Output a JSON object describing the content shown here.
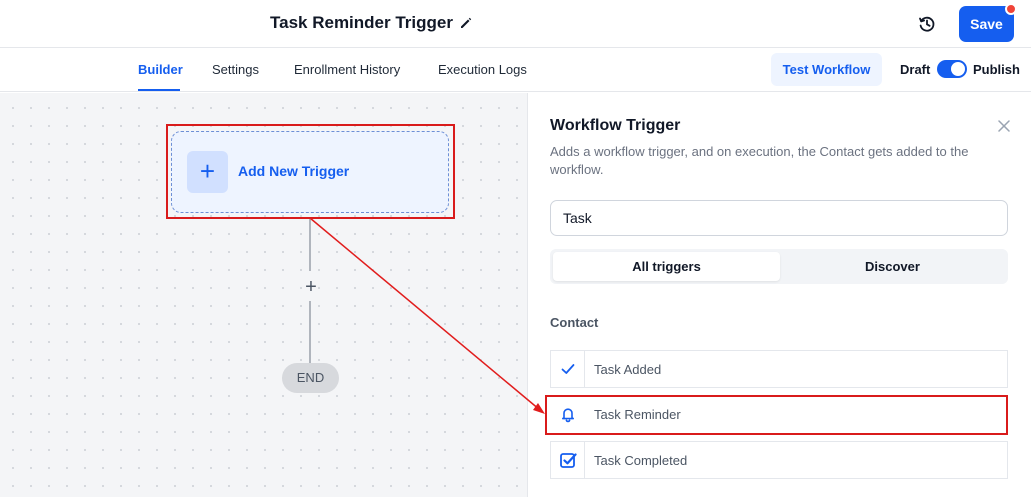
{
  "header": {
    "workflow_title": "Task Reminder Trigger",
    "save_label": "Save"
  },
  "tabs": [
    {
      "label": "Builder",
      "active": true
    },
    {
      "label": "Settings",
      "active": false
    },
    {
      "label": "Enrollment History",
      "active": false
    },
    {
      "label": "Execution Logs",
      "active": false
    }
  ],
  "toolbar": {
    "test_label": "Test Workflow",
    "draft_label": "Draft",
    "publish_label": "Publish",
    "published": true
  },
  "canvas": {
    "trigger_label": "Add New Trigger",
    "add_step_symbol": "+",
    "end_label": "END"
  },
  "panel": {
    "title": "Workflow Trigger",
    "description": "Adds a workflow trigger, and on execution, the Contact gets added to the workflow.",
    "search_value": "Task",
    "segments": [
      {
        "label": "All triggers",
        "active": true
      },
      {
        "label": "Discover",
        "active": false
      }
    ],
    "section_label": "Contact",
    "options": [
      {
        "label": "Task Added",
        "icon": "checkmark-icon"
      },
      {
        "label": "Task Reminder",
        "icon": "bell-icon"
      },
      {
        "label": "Task Completed",
        "icon": "checkbox-checked-icon"
      }
    ]
  },
  "colors": {
    "accent": "#155eef",
    "annotation_red": "#d91b1b",
    "notification_dot": "#f04438"
  }
}
